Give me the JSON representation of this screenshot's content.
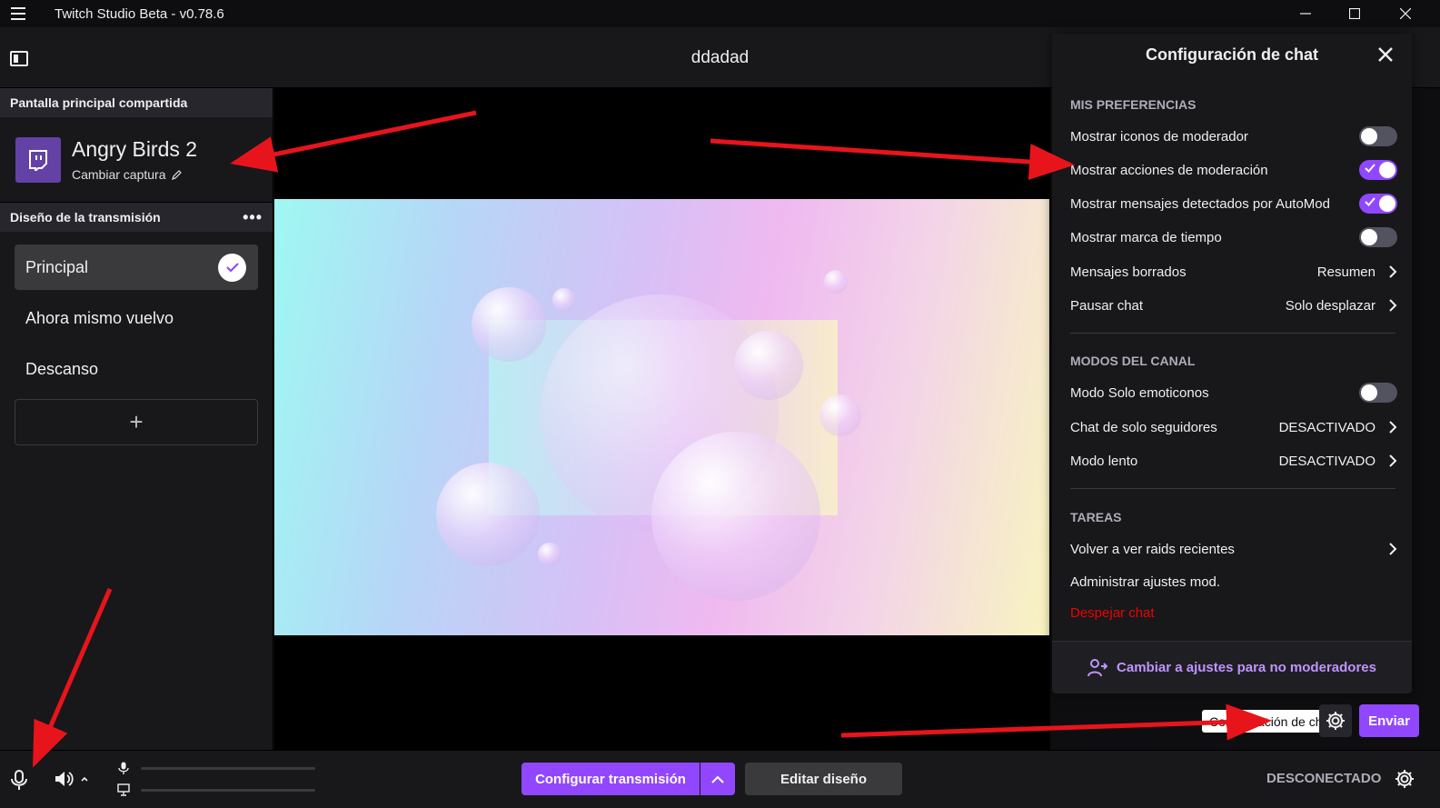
{
  "window": {
    "title": "Twitch Studio Beta - v0.78.6"
  },
  "header": {
    "scene_name": "ddadad"
  },
  "sidebar": {
    "capture_section_title": "Pantalla principal compartida",
    "capture_name": "Angry Birds 2",
    "capture_change_label": "Cambiar captura",
    "layout_section_title": "Diseño de la transmisión",
    "layouts": [
      {
        "label": "Principal",
        "active": true
      },
      {
        "label": "Ahora mismo vuelvo",
        "active": false
      },
      {
        "label": "Descanso",
        "active": false
      }
    ],
    "add_label": "+"
  },
  "chat_settings": {
    "title": "Configuración de chat",
    "sections": {
      "preferences": "MIS PREFERENCIAS",
      "channel_modes": "MODOS DEL CANAL",
      "tasks": "TAREAS"
    },
    "preferences": [
      {
        "label": "Mostrar iconos de moderador",
        "toggle": false
      },
      {
        "label": "Mostrar acciones de moderación",
        "toggle": true
      },
      {
        "label": "Mostrar mensajes detectados por AutoMod",
        "toggle": true
      },
      {
        "label": "Mostrar marca de tiempo",
        "toggle": false
      },
      {
        "label": "Mensajes borrados",
        "value": "Resumen"
      },
      {
        "label": "Pausar chat",
        "value": "Solo desplazar"
      }
    ],
    "channel_modes": [
      {
        "label": "Modo Solo emoticonos",
        "toggle": false
      },
      {
        "label": "Chat de solo seguidores",
        "value": "DESACTIVADO"
      },
      {
        "label": "Modo lento",
        "value": "DESACTIVADO"
      }
    ],
    "tasks": [
      {
        "label": "Volver a ver raids recientes"
      },
      {
        "label": "Administrar ajustes mod."
      },
      {
        "label": "Despejar chat"
      }
    ],
    "footer_link": "Cambiar a ajustes para no moderadores"
  },
  "chat_controls": {
    "tooltip": "Configuración de chat",
    "send_label": "Enviar"
  },
  "bottom_bar": {
    "configure_label": "Configurar transmisión",
    "edit_label": "Editar diseño",
    "status": "DESCONECTADO"
  },
  "colors": {
    "accent": "#9147ff",
    "background": "#0e0e10",
    "panel": "#18181b",
    "danger": "#eb0400",
    "annotation": "#e8141c"
  }
}
